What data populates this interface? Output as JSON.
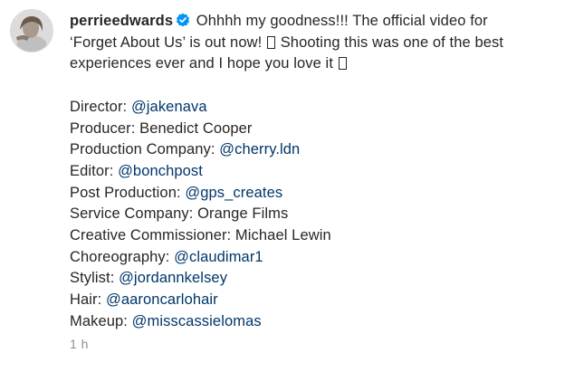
{
  "post": {
    "username": "perrieedwards",
    "caption": {
      "line1": "Ohhhh my goodness!!! The official video for",
      "line2a": "‘Forget About Us’ is out now!",
      "line2b": "Shooting this was one of the best",
      "line3": "experiences ever and I hope you love it"
    },
    "credits": [
      {
        "label": "Director: ",
        "handle": "@jakenava"
      },
      {
        "label": "Producer: Benedict Cooper",
        "handle": ""
      },
      {
        "label": "Production Company: ",
        "handle": "@cherry.ldn"
      },
      {
        "label": "Editor: ",
        "handle": "@bonchpost"
      },
      {
        "label": "Post Production: ",
        "handle": "@gps_creates"
      },
      {
        "label": "Service Company: Orange Films",
        "handle": ""
      },
      {
        "label": "Creative Commissioner: Michael Lewin",
        "handle": ""
      },
      {
        "label": "Choreography: ",
        "handle": "@claudimar1"
      },
      {
        "label": "Stylist: ",
        "handle": "@jordannkelsey"
      },
      {
        "label": "Hair: ",
        "handle": "@aaroncarlohair"
      },
      {
        "label": "Makeup: ",
        "handle": "@misscassielomas"
      }
    ],
    "timestamp": "1 h"
  },
  "icons": {
    "verified": "verified-badge-icon",
    "emoji_placeholder": "missing-glyph-box-icon"
  },
  "colors": {
    "text": "#262626",
    "mention": "#00376b",
    "muted": "#8e8e8e",
    "verified": "#0095f6"
  }
}
